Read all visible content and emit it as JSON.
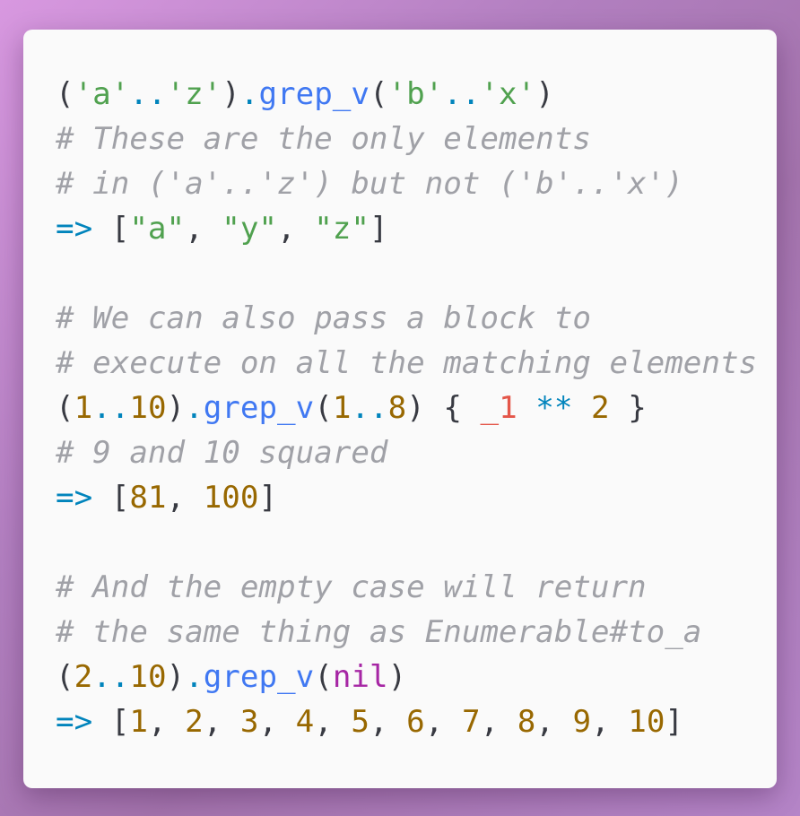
{
  "colors": {
    "background_gradient": [
      "#d898e0",
      "#a474ad",
      "#b585c8"
    ],
    "card": "#fafafa",
    "punctuation": "#383a42",
    "string": "#50a14f",
    "operator": "#0184bc",
    "method": "#4078f2",
    "comment": "#a0a1a7",
    "number": "#986801",
    "variable": "#e45649",
    "keyword": "#a626a4"
  },
  "code": {
    "language": "ruby",
    "lines": [
      [
        {
          "t": "pun",
          "v": "("
        },
        {
          "t": "str",
          "v": "'a'"
        },
        {
          "t": "op",
          "v": ".."
        },
        {
          "t": "str",
          "v": "'z'"
        },
        {
          "t": "pun",
          "v": ")"
        },
        {
          "t": "op",
          "v": "."
        },
        {
          "t": "meth",
          "v": "grep_v"
        },
        {
          "t": "pun",
          "v": "("
        },
        {
          "t": "str",
          "v": "'b'"
        },
        {
          "t": "op",
          "v": ".."
        },
        {
          "t": "str",
          "v": "'x'"
        },
        {
          "t": "pun",
          "v": ")"
        }
      ],
      [
        {
          "t": "cmt",
          "v": "# These are the only elements"
        }
      ],
      [
        {
          "t": "cmt",
          "v": "# in ('a'..'z') but not ('b'..'x')"
        }
      ],
      [
        {
          "t": "op",
          "v": "=>"
        },
        {
          "t": "pun",
          "v": " ["
        },
        {
          "t": "str",
          "v": "\"a\""
        },
        {
          "t": "pun",
          "v": ", "
        },
        {
          "t": "str",
          "v": "\"y\""
        },
        {
          "t": "pun",
          "v": ", "
        },
        {
          "t": "str",
          "v": "\"z\""
        },
        {
          "t": "pun",
          "v": "]"
        }
      ],
      [],
      [
        {
          "t": "cmt",
          "v": "# We can also pass a block to"
        }
      ],
      [
        {
          "t": "cmt",
          "v": "# execute on all the matching elements"
        }
      ],
      [
        {
          "t": "pun",
          "v": "("
        },
        {
          "t": "num",
          "v": "1"
        },
        {
          "t": "op",
          "v": ".."
        },
        {
          "t": "num",
          "v": "10"
        },
        {
          "t": "pun",
          "v": ")"
        },
        {
          "t": "op",
          "v": "."
        },
        {
          "t": "meth",
          "v": "grep_v"
        },
        {
          "t": "pun",
          "v": "("
        },
        {
          "t": "num",
          "v": "1"
        },
        {
          "t": "op",
          "v": ".."
        },
        {
          "t": "num",
          "v": "8"
        },
        {
          "t": "pun",
          "v": ") { "
        },
        {
          "t": "var",
          "v": "_1"
        },
        {
          "t": "pun",
          "v": " "
        },
        {
          "t": "op",
          "v": "**"
        },
        {
          "t": "pun",
          "v": " "
        },
        {
          "t": "num",
          "v": "2"
        },
        {
          "t": "pun",
          "v": " }"
        }
      ],
      [
        {
          "t": "cmt",
          "v": "# 9 and 10 squared"
        }
      ],
      [
        {
          "t": "op",
          "v": "=>"
        },
        {
          "t": "pun",
          "v": " ["
        },
        {
          "t": "num",
          "v": "81"
        },
        {
          "t": "pun",
          "v": ", "
        },
        {
          "t": "num",
          "v": "100"
        },
        {
          "t": "pun",
          "v": "]"
        }
      ],
      [],
      [
        {
          "t": "cmt",
          "v": "# And the empty case will return"
        }
      ],
      [
        {
          "t": "cmt",
          "v": "# the same thing as Enumerable#to_a"
        }
      ],
      [
        {
          "t": "pun",
          "v": "("
        },
        {
          "t": "num",
          "v": "2"
        },
        {
          "t": "op",
          "v": ".."
        },
        {
          "t": "num",
          "v": "10"
        },
        {
          "t": "pun",
          "v": ")"
        },
        {
          "t": "op",
          "v": "."
        },
        {
          "t": "meth",
          "v": "grep_v"
        },
        {
          "t": "pun",
          "v": "("
        },
        {
          "t": "kw",
          "v": "nil"
        },
        {
          "t": "pun",
          "v": ")"
        }
      ],
      [
        {
          "t": "op",
          "v": "=>"
        },
        {
          "t": "pun",
          "v": " ["
        },
        {
          "t": "num",
          "v": "1"
        },
        {
          "t": "pun",
          "v": ", "
        },
        {
          "t": "num",
          "v": "2"
        },
        {
          "t": "pun",
          "v": ", "
        },
        {
          "t": "num",
          "v": "3"
        },
        {
          "t": "pun",
          "v": ", "
        },
        {
          "t": "num",
          "v": "4"
        },
        {
          "t": "pun",
          "v": ", "
        },
        {
          "t": "num",
          "v": "5"
        },
        {
          "t": "pun",
          "v": ", "
        },
        {
          "t": "num",
          "v": "6"
        },
        {
          "t": "pun",
          "v": ", "
        },
        {
          "t": "num",
          "v": "7"
        },
        {
          "t": "pun",
          "v": ", "
        },
        {
          "t": "num",
          "v": "8"
        },
        {
          "t": "pun",
          "v": ", "
        },
        {
          "t": "num",
          "v": "9"
        },
        {
          "t": "pun",
          "v": ", "
        },
        {
          "t": "num",
          "v": "10"
        },
        {
          "t": "pun",
          "v": "]"
        }
      ]
    ]
  }
}
